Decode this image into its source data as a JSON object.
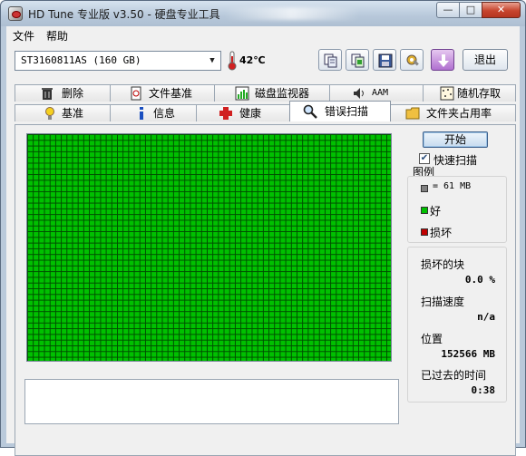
{
  "titlebar": {
    "title": "HD Tune 专业版 v3.50 - 硬盘专业工具",
    "min_label": "—",
    "max_label": "□",
    "close_label": "✕"
  },
  "menu": {
    "file": "文件",
    "help": "帮助"
  },
  "toolbar": {
    "drive": "ST3160811AS (160 GB)",
    "temperature": "42℃",
    "exit_label": "退出"
  },
  "tabs_top": [
    "删除",
    "文件基准",
    "磁盘监视器",
    "AAM",
    "随机存取"
  ],
  "tabs_bottom": [
    "基准",
    "信息",
    "健康",
    "错误扫描",
    "文件夹占用率"
  ],
  "active_tab": "错误扫描",
  "scan": {
    "start_label": "开始",
    "quick_scan_label": "快速扫描",
    "quick_scan_checked": true,
    "legend_title": "图例",
    "legend": [
      {
        "label": "= 61 MB",
        "color": "#808080"
      },
      {
        "label": "好",
        "color": "#00c000"
      },
      {
        "label": "损坏",
        "color": "#c00000"
      }
    ],
    "damaged_blocks_label": "损坏的块",
    "damaged_blocks_value": "0.0 %",
    "scan_speed_label": "扫描速度",
    "scan_speed_value": "n/a",
    "position_label": "位置",
    "position_value": "152566 MB",
    "elapsed_label": "已过去的时间",
    "elapsed_value": "0:38"
  },
  "colors": {
    "good_block": "#00c000",
    "damaged_block": "#c00000",
    "grid_line": "#004d00"
  }
}
